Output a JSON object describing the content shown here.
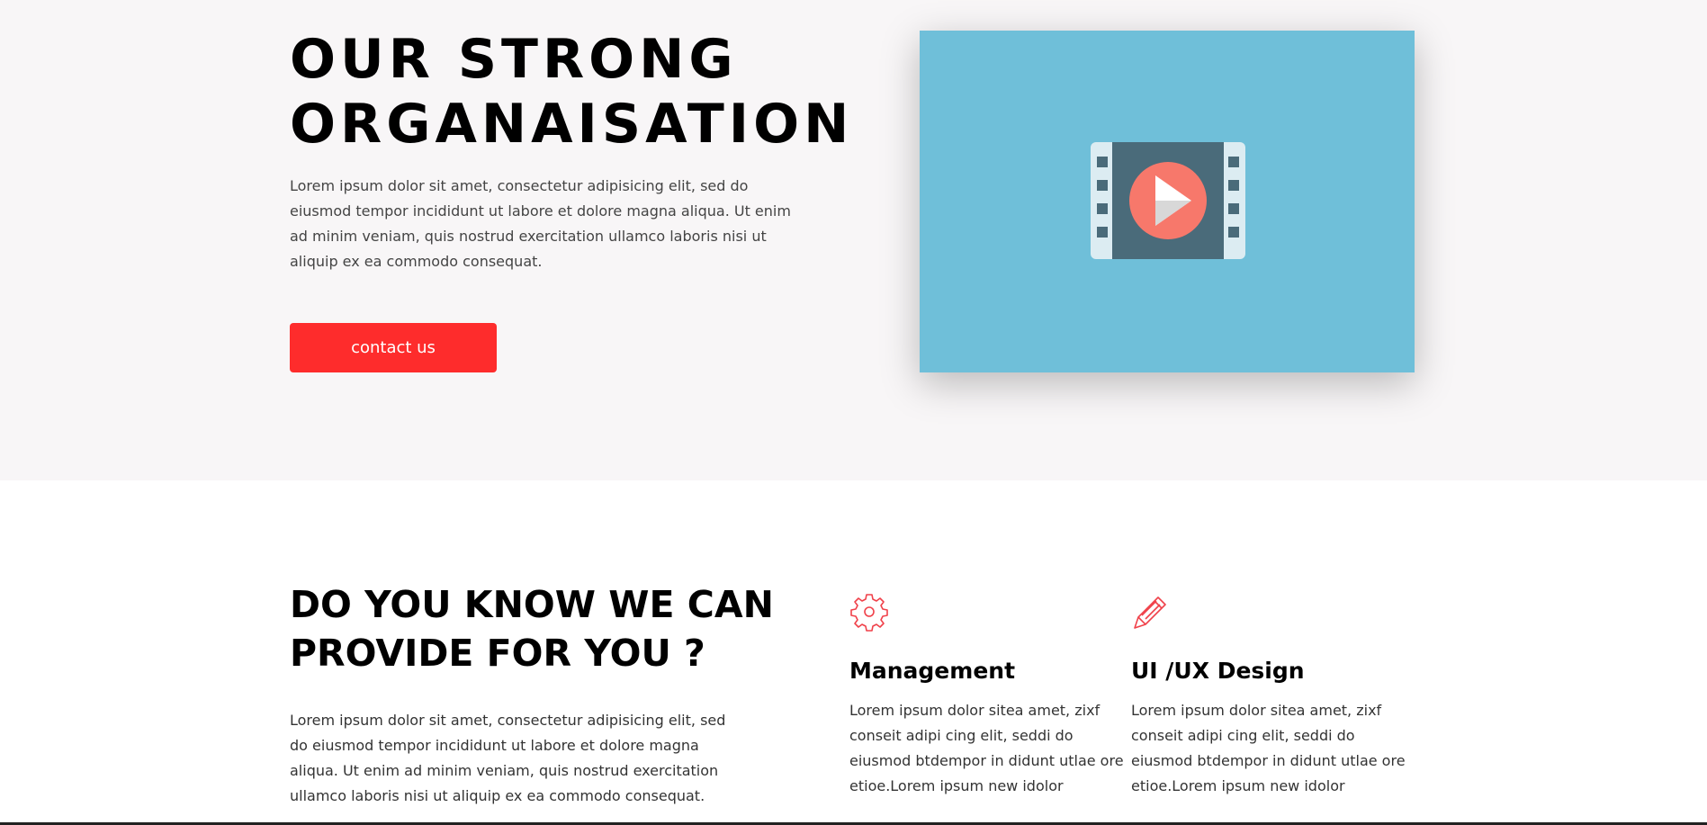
{
  "hero": {
    "title_line1": "OUR STRONG",
    "title_line2": "ORGANAISATION",
    "text": "Lorem ipsum dolor sit amet, consectetur adipisicing elit, sed do eiusmod tempor incididunt ut labore et dolore magna aliqua. Ut enim ad minim veniam, quis nostrud exercitation ullamco laboris nisi ut aliquip ex ea commodo consequat.",
    "button_label": "contact us",
    "colors": {
      "background": "#f8f6f7",
      "button": "#fe2c2c",
      "video_card": "#6fbfd9"
    },
    "video_icon": "film-play-icon"
  },
  "services_section": {
    "title_line1": "DO YOU KNOW WE CAN",
    "title_line2": "PROVIDE FOR YOU ?",
    "text": "Lorem ipsum dolor sit amet, consectetur adipisicing elit, sed do eiusmod tempor incididunt ut labore et dolore magna aliqua. Ut enim ad minim veniam, quis nostrud exercitation ullamco laboris nisi ut aliquip ex ea commodo consequat.",
    "items": [
      {
        "icon": "gear-icon",
        "title": "Management",
        "text": "Lorem ipsum dolor sitea amet, zixf conseit adipi cing elit, seddi do eiusmod btdempor in didunt utlae ore etioe.Lorem ipsum new idolor"
      },
      {
        "icon": "pencil-icon",
        "title": "UI /UX Design",
        "text": "Lorem ipsum dolor sitea amet, zixf conseit adipi cing elit, seddi do eiusmod btdempor in didunt utlae ore etioe.Lorem ipsum new idolor"
      }
    ],
    "accent_color": "#f0414a"
  }
}
